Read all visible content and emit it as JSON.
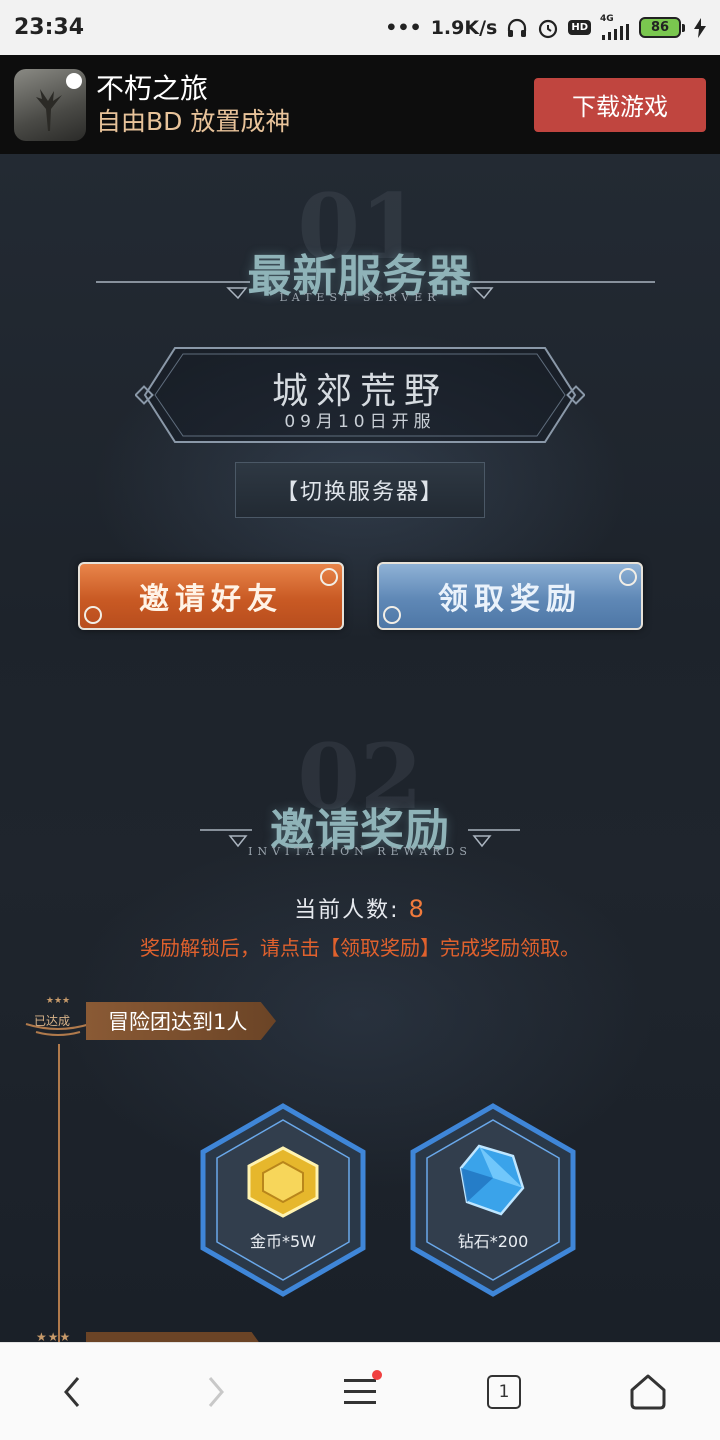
{
  "status_bar": {
    "time": "23:34",
    "speed": "1.9K/s",
    "hd": "HD",
    "network": "4G",
    "battery": "86"
  },
  "banner": {
    "app_name": "不朽之旅",
    "slogan": "自由BD 放置成神",
    "download": "下载游戏"
  },
  "section1": {
    "number": "01",
    "title": "最新服务器",
    "subtitle": "LATEST SERVER",
    "server_name": "城郊荒野",
    "server_date": "09月10日开服",
    "switch_label": "【切换服务器】",
    "invite_label": "邀请好友",
    "claim_label": "领取奖励"
  },
  "section2": {
    "number": "02",
    "title": "邀请奖励",
    "subtitle": "INVITATION REWARDS",
    "count_label": "当前人数:",
    "count_value": "8",
    "hint": "奖励解锁后，请点击【领取奖励】完成奖励领取。",
    "milestone_badge": "已达成",
    "milestone_label": "冒险团达到1人",
    "rewards": [
      {
        "label": "金币*5W",
        "icon": "gold-coin-icon"
      },
      {
        "label": "钻石*200",
        "icon": "diamond-icon"
      }
    ]
  },
  "bottom_nav": {
    "tab_count": "1"
  },
  "colors": {
    "accent_orange": "#e0612d",
    "download_red": "#c0453f",
    "invite_orange": "#c95a24",
    "claim_blue": "#5f88b6"
  }
}
